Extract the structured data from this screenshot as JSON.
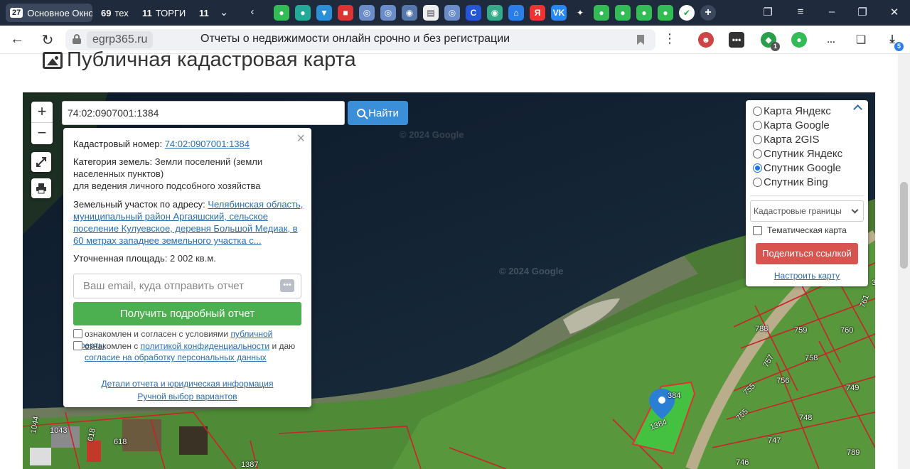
{
  "browser": {
    "tabs": [
      {
        "count": "27",
        "label": "Основное Окно"
      },
      {
        "count": "69",
        "label": "тех"
      },
      {
        "count": "11",
        "label": "ТОРГИ"
      },
      {
        "count": "11",
        "label": ""
      }
    ],
    "url": "egrp365.ru",
    "page_title": "Отчеты о недвижимости онлайн срочно и без регистрации",
    "download_badge": "5",
    "ext_badge": "1"
  },
  "page": {
    "heading": "Публичная кадастровая карта"
  },
  "map": {
    "search_value": "74:02:0907001:1384",
    "find_label": "Найти",
    "watermarks": [
      "© 2024 Google",
      "© 2024 Google"
    ],
    "parcel_labels": [
      "788",
      "759",
      "760",
      "761",
      "757",
      "758",
      "756",
      "755",
      "749",
      "748",
      "747",
      "746",
      "789",
      "755",
      "1384",
      "384",
      "1043",
      "1044",
      "618",
      "618",
      "1387",
      "3"
    ],
    "popup": {
      "cadastral_label": "Кадастровый номер:",
      "cadastral_value": "74:02:0907001:1384",
      "category_label": "Категория земель:",
      "category_value": "Земли поселений (земли населенных пунктов)",
      "usage": "для ведения личного подсобного хозяйства",
      "address_label": "Земельный участок по адресу:",
      "address_value": "Челябинская область, муниципальный район Аргаяшский, сельское поселение Кулуевское, деревня Большой Медиак, в 60 метрах западнее земельного участка с...",
      "area_label": "Уточненная площадь:",
      "area_value": "2 002 кв.м.",
      "email_placeholder": "Ваш email, куда отправить отчет",
      "get_report": "Получить подробный отчет",
      "agree1_text": "ознакомлен и согласен с условиями ",
      "agree1_link": "публичной оферты",
      "agree2_text": "ознакомлен с ",
      "agree2_link": "политикой конфиденциальности",
      "agree2_mid": " и даю ",
      "agree2_link2": "согласие на обработку персональных данных",
      "details_link": "Детали отчета и юридическая информация",
      "manual_link": "Ручной выбор вариантов"
    },
    "layers": {
      "options": [
        "Карта Яндекс",
        "Карта Google",
        "Карта 2GIS",
        "Спутник Яндекс",
        "Спутник Google",
        "Спутник Bing"
      ],
      "selected": "Спутник Google",
      "borders_select": "Кадастровые границы",
      "thematic": "Тематическая карта",
      "share": "Поделиться ссылкой",
      "configure": "Настроить карту"
    }
  }
}
